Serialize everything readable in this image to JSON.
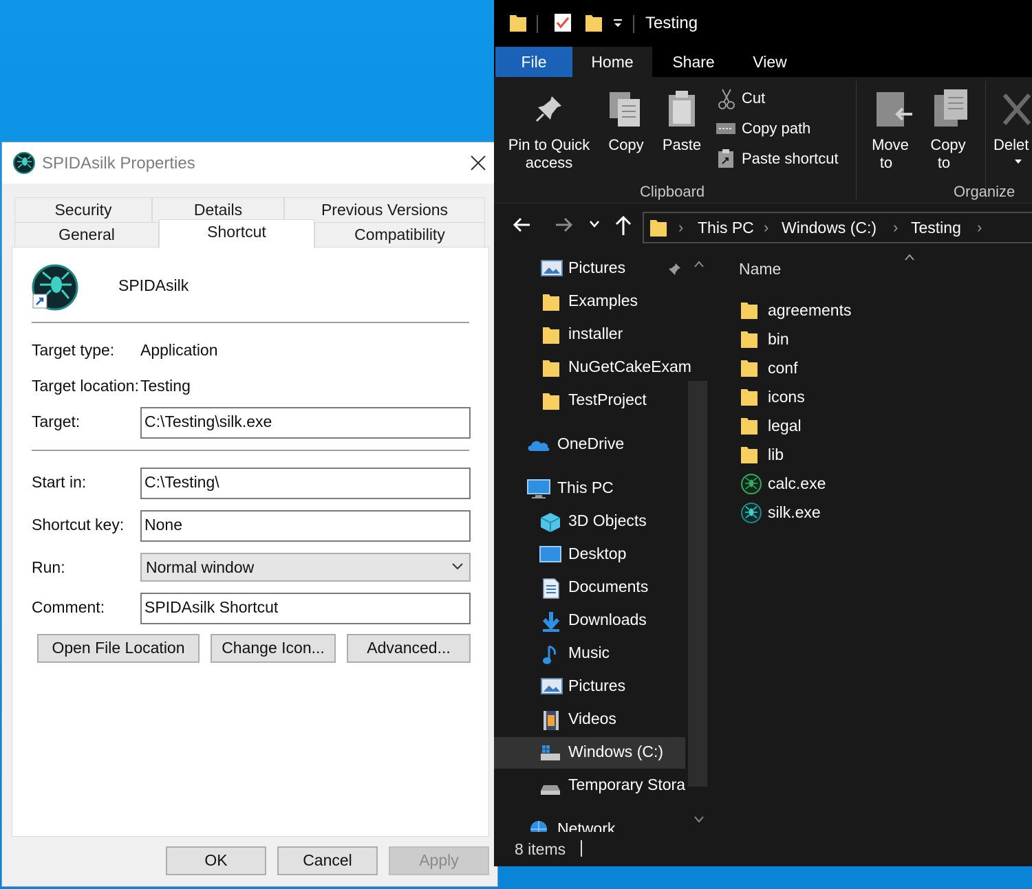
{
  "dialog": {
    "title": "SPIDAsilk Properties",
    "tabs_row1": [
      "Security",
      "Details",
      "Previous Versions"
    ],
    "tabs_row2": [
      "General",
      "Shortcut",
      "Compatibility"
    ],
    "active_tab": "Shortcut",
    "shortcut_name": "SPIDAsilk",
    "target_type_label": "Target type:",
    "target_type_value": "Application",
    "target_location_label": "Target location:",
    "target_location_value": "Testing",
    "target_label": "Target:",
    "target_value": "C:\\Testing\\silk.exe",
    "start_in_label": "Start in:",
    "start_in_value": "C:\\Testing\\",
    "shortcut_key_label": "Shortcut key:",
    "shortcut_key_value": "None",
    "run_label": "Run:",
    "run_value": "Normal window",
    "comment_label": "Comment:",
    "comment_value": "SPIDAsilk Shortcut",
    "open_file_location": "Open File Location",
    "change_icon": "Change Icon...",
    "advanced": "Advanced...",
    "ok": "OK",
    "cancel": "Cancel",
    "apply": "Apply"
  },
  "explorer": {
    "window_title": "Testing",
    "ribbon_tabs": [
      "File",
      "Home",
      "Share",
      "View"
    ],
    "ribbon": {
      "pin_line1": "Pin to Quick",
      "pin_line2": "access",
      "copy": "Copy",
      "paste": "Paste",
      "cut": "Cut",
      "copy_path": "Copy path",
      "paste_shortcut": "Paste shortcut",
      "move_line1": "Move",
      "move_line2": "to",
      "copyto_line1": "Copy",
      "copyto_line2": "to",
      "delete": "Delet",
      "group_clipboard": "Clipboard",
      "group_organize": "Organize"
    },
    "address": [
      "This PC",
      "Windows (C:)",
      "Testing"
    ],
    "nav_items": [
      {
        "label": "Pictures",
        "icon": "pictures-icon",
        "pinned": true
      },
      {
        "label": "Examples",
        "icon": "folder-icon"
      },
      {
        "label": "installer",
        "icon": "folder-icon"
      },
      {
        "label": "NuGetCakeExam",
        "icon": "folder-icon"
      },
      {
        "label": "TestProject",
        "icon": "folder-icon"
      },
      {
        "label": "OneDrive",
        "icon": "onedrive-icon"
      },
      {
        "label": "This PC",
        "icon": "computer-icon"
      },
      {
        "label": "3D Objects",
        "icon": "3d-objects-icon"
      },
      {
        "label": "Desktop",
        "icon": "desktop-icon"
      },
      {
        "label": "Documents",
        "icon": "documents-icon"
      },
      {
        "label": "Downloads",
        "icon": "downloads-icon"
      },
      {
        "label": "Music",
        "icon": "music-icon"
      },
      {
        "label": "Pictures",
        "icon": "pictures-icon"
      },
      {
        "label": "Videos",
        "icon": "videos-icon"
      },
      {
        "label": "Windows (C:)",
        "icon": "drive-icon",
        "selected": true
      },
      {
        "label": "Temporary Stora",
        "icon": "drive-icon"
      },
      {
        "label": "Network",
        "icon": "network-icon"
      }
    ],
    "column_name": "Name",
    "files": [
      {
        "name": "agreements",
        "icon": "folder-icon"
      },
      {
        "name": "bin",
        "icon": "folder-icon"
      },
      {
        "name": "conf",
        "icon": "folder-icon"
      },
      {
        "name": "icons",
        "icon": "folder-icon"
      },
      {
        "name": "legal",
        "icon": "folder-icon"
      },
      {
        "name": "lib",
        "icon": "folder-icon"
      },
      {
        "name": "calc.exe",
        "icon": "spider-app-icon"
      },
      {
        "name": "silk.exe",
        "icon": "spider-app-icon"
      }
    ],
    "status": "8 items"
  },
  "colors": {
    "desktop": "#0a8ddf",
    "file_tab": "#1a62b8",
    "explorer_bg": "#191919",
    "folder": "#f7cf5f"
  }
}
